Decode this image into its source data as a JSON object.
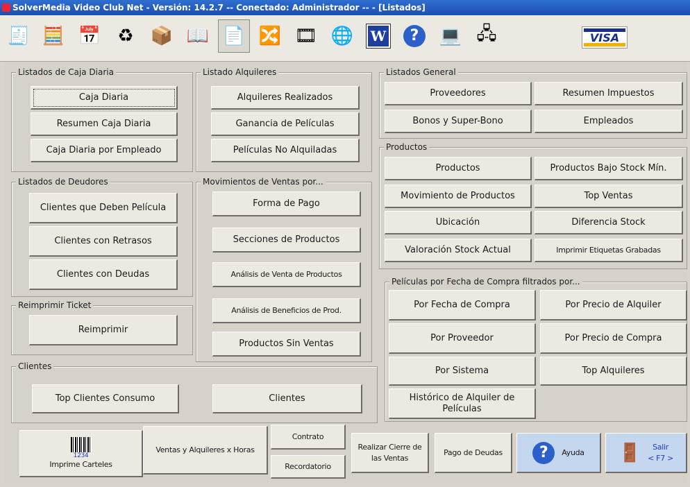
{
  "title_bar": "SolverMedia Video Club Net   -   Versión: 14.2.7   --  Conectado: Administrador  --  - [Listados]",
  "toolbar": {
    "icons": [
      "cash-register-icon",
      "calculator-icon",
      "calendar-icon",
      "recycle-bin-icon",
      "package-icon",
      "book-icon",
      "document-icon",
      "transfer-icon",
      "film-reel-icon",
      "globe-icon",
      "word-icon",
      "help-icon",
      "computer-icon",
      "network-icon"
    ],
    "visa_label": "VISA"
  },
  "caja": {
    "legend": "Listados de Caja Diaria",
    "b1": "Caja Diaria",
    "b2": "Resumen Caja Diaria",
    "b3": "Caja Diaria por Empleado"
  },
  "alquileres": {
    "legend": "Listado Alquileres",
    "b1": "Alquileres Realizados",
    "b2": "Ganancia de Películas",
    "b3": "Películas No Alquiladas"
  },
  "general": {
    "legend": "Listados General",
    "b1": "Proveedores",
    "b2": "Resumen Impuestos",
    "b3": "Bonos y Super-Bono",
    "b4": "Empleados"
  },
  "productos": {
    "legend": "Productos",
    "b1": "Productos",
    "b2": "Productos Bajo Stock Mín.",
    "b3": "Movimiento de Productos",
    "b4": "Top Ventas",
    "b5": "Ubicación",
    "b6": "Diferencia Stock",
    "b7": "Valoración Stock Actual",
    "b8": "Imprimir Etiquetas Grabadas"
  },
  "deudores": {
    "legend": "Listados de Deudores",
    "b1": "Clientes que Deben Película",
    "b2": "Clientes con Retrasos",
    "b3": "Clientes con Deudas"
  },
  "ventas": {
    "legend": "Movimientos de Ventas por...",
    "b1": "Forma de Pago",
    "b2": "Secciones de Productos",
    "b3": "Análisis de Venta de Productos",
    "b4": "Análisis de Beneficios de Prod.",
    "b5": "Productos Sin Ventas"
  },
  "ticket": {
    "legend": "Reimprimir Ticket",
    "b1": "Reimprimir"
  },
  "peliculas": {
    "legend": "Películas por Fecha de Compra filtrados por...",
    "b1": "Por Fecha de Compra",
    "b2": "Por Precio de Alquiler",
    "b3": "Por Proveedor",
    "b4": "Por Precio de Compra",
    "b5": "Por Sistema",
    "b6": "Top Alquileres",
    "b7": "Histórico de Alquiler de Películas"
  },
  "clientes": {
    "legend": "Clientes",
    "b1": "Top Clientes Consumo",
    "b2": "Clientes"
  },
  "bottom": {
    "barcode_number": "1234",
    "imprime": "Imprime Carteles",
    "ventas_horas": "Ventas y Alquileres x Horas",
    "contrato": "Contrato",
    "recordatorio": "Recordatorio",
    "cierre": "Realizar Cierre de las Ventas",
    "pago": "Pago de Deudas",
    "ayuda": "Ayuda",
    "salir": "Salir",
    "salir_key": "< F7 >"
  }
}
